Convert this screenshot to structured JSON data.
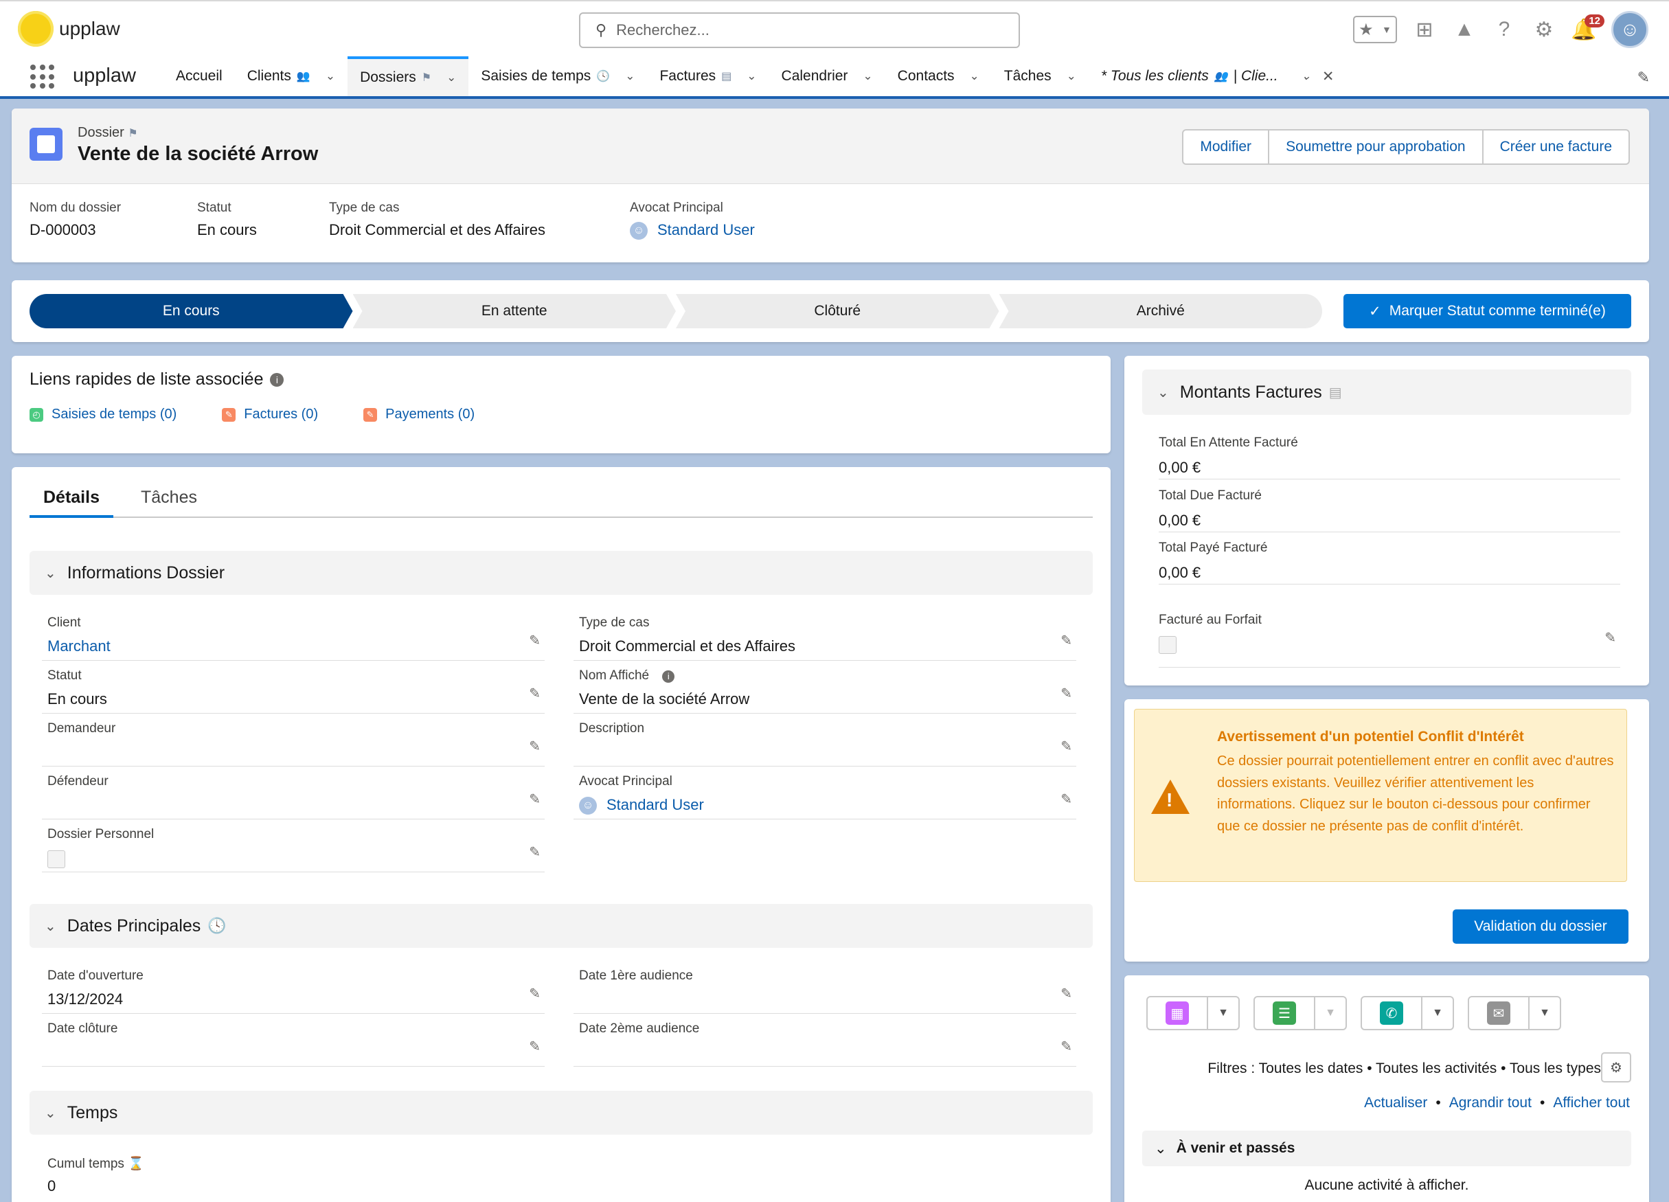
{
  "header": {
    "logo_text": "upplaw",
    "search_placeholder": "Recherchez...",
    "notification_count": "12"
  },
  "nav": {
    "app_name": "upplaw",
    "tabs": [
      {
        "label": "Accueil"
      },
      {
        "label": "Clients"
      },
      {
        "label": "Dossiers"
      },
      {
        "label": "Saisies de temps"
      },
      {
        "label": "Factures"
      },
      {
        "label": "Calendrier"
      },
      {
        "label": "Contacts"
      },
      {
        "label": "Tâches"
      },
      {
        "label": "* Tous les clients",
        "suffix": "| Clie..."
      }
    ]
  },
  "record": {
    "object_label": "Dossier",
    "title": "Vente de la société Arrow",
    "actions": [
      "Modifier",
      "Soumettre pour approbation",
      "Créer une facture"
    ],
    "fields": [
      {
        "label": "Nom du dossier",
        "value": "D-000003"
      },
      {
        "label": "Statut",
        "value": "En cours"
      },
      {
        "label": "Type de cas",
        "value": "Droit Commercial et des Affaires"
      },
      {
        "label": "Avocat Principal",
        "value": "Standard User"
      }
    ]
  },
  "path": {
    "steps": [
      "En cours",
      "En attente",
      "Clôturé",
      "Archivé"
    ],
    "current": "En cours",
    "mark_button": "Marquer Statut comme terminé(e)"
  },
  "quicklinks": {
    "title": "Liens rapides de liste associée",
    "links": [
      "Saisies de temps (0)",
      "Factures (0)",
      "Payements (0)"
    ]
  },
  "detail": {
    "tabs": [
      "Détails",
      "Tâches"
    ],
    "sections": {
      "info": "Informations Dossier",
      "dates": "Dates Principales",
      "temps": "Temps"
    },
    "info_left": [
      {
        "label": "Client",
        "value": "Marchant"
      },
      {
        "label": "Statut",
        "value": "En cours"
      },
      {
        "label": "Demandeur",
        "value": ""
      },
      {
        "label": "Défendeur",
        "value": ""
      },
      {
        "label": "Dossier Personnel",
        "value": ""
      }
    ],
    "info_right": [
      {
        "label": "Type de cas",
        "value": "Droit Commercial et des Affaires"
      },
      {
        "label": "Nom Affiché",
        "value": "Vente de la société Arrow"
      },
      {
        "label": "Description",
        "value": ""
      },
      {
        "label": "Avocat Principal",
        "value": "Standard User"
      }
    ],
    "dates_left": [
      {
        "label": "Date d'ouverture",
        "value": "13/12/2024"
      },
      {
        "label": "Date clôture",
        "value": ""
      }
    ],
    "dates_right": [
      {
        "label": "Date 1ère audience",
        "value": ""
      },
      {
        "label": "Date 2ème audience",
        "value": ""
      }
    ],
    "temps": [
      {
        "label": "Cumul temps",
        "value": "0"
      }
    ]
  },
  "montants": {
    "title": "Montants Factures",
    "rows": [
      {
        "label": "Total En Attente Facturé",
        "value": "0,00 €"
      },
      {
        "label": "Total Due Facturé",
        "value": "0,00 €"
      },
      {
        "label": "Total Payé Facturé",
        "value": "0,00 €"
      },
      {
        "label": "Facturé au Forfait",
        "value": ""
      }
    ]
  },
  "warning": {
    "title": "Avertissement d'un potentiel Conflit d'Intérêt",
    "text": "Ce dossier pourrait potentiellement entrer en conflit avec d'autres dossiers existants. Veuillez vérifier attentivement les informations. Cliquez sur le bouton ci-dessous pour confirmer que ce dossier ne présente pas de conflit d'intérêt.",
    "button": "Validation du dossier"
  },
  "activity": {
    "filters": "Filtres : Toutes les dates • Toutes les activités • Tous les types",
    "links": [
      "Actualiser",
      "Agrandir tout",
      "Afficher tout"
    ],
    "section": "À venir et passés",
    "empty": "Aucune activité à afficher."
  },
  "colors": {
    "brand": "#0176d3",
    "path_active": "#014486",
    "warning": "#dd7a01"
  }
}
